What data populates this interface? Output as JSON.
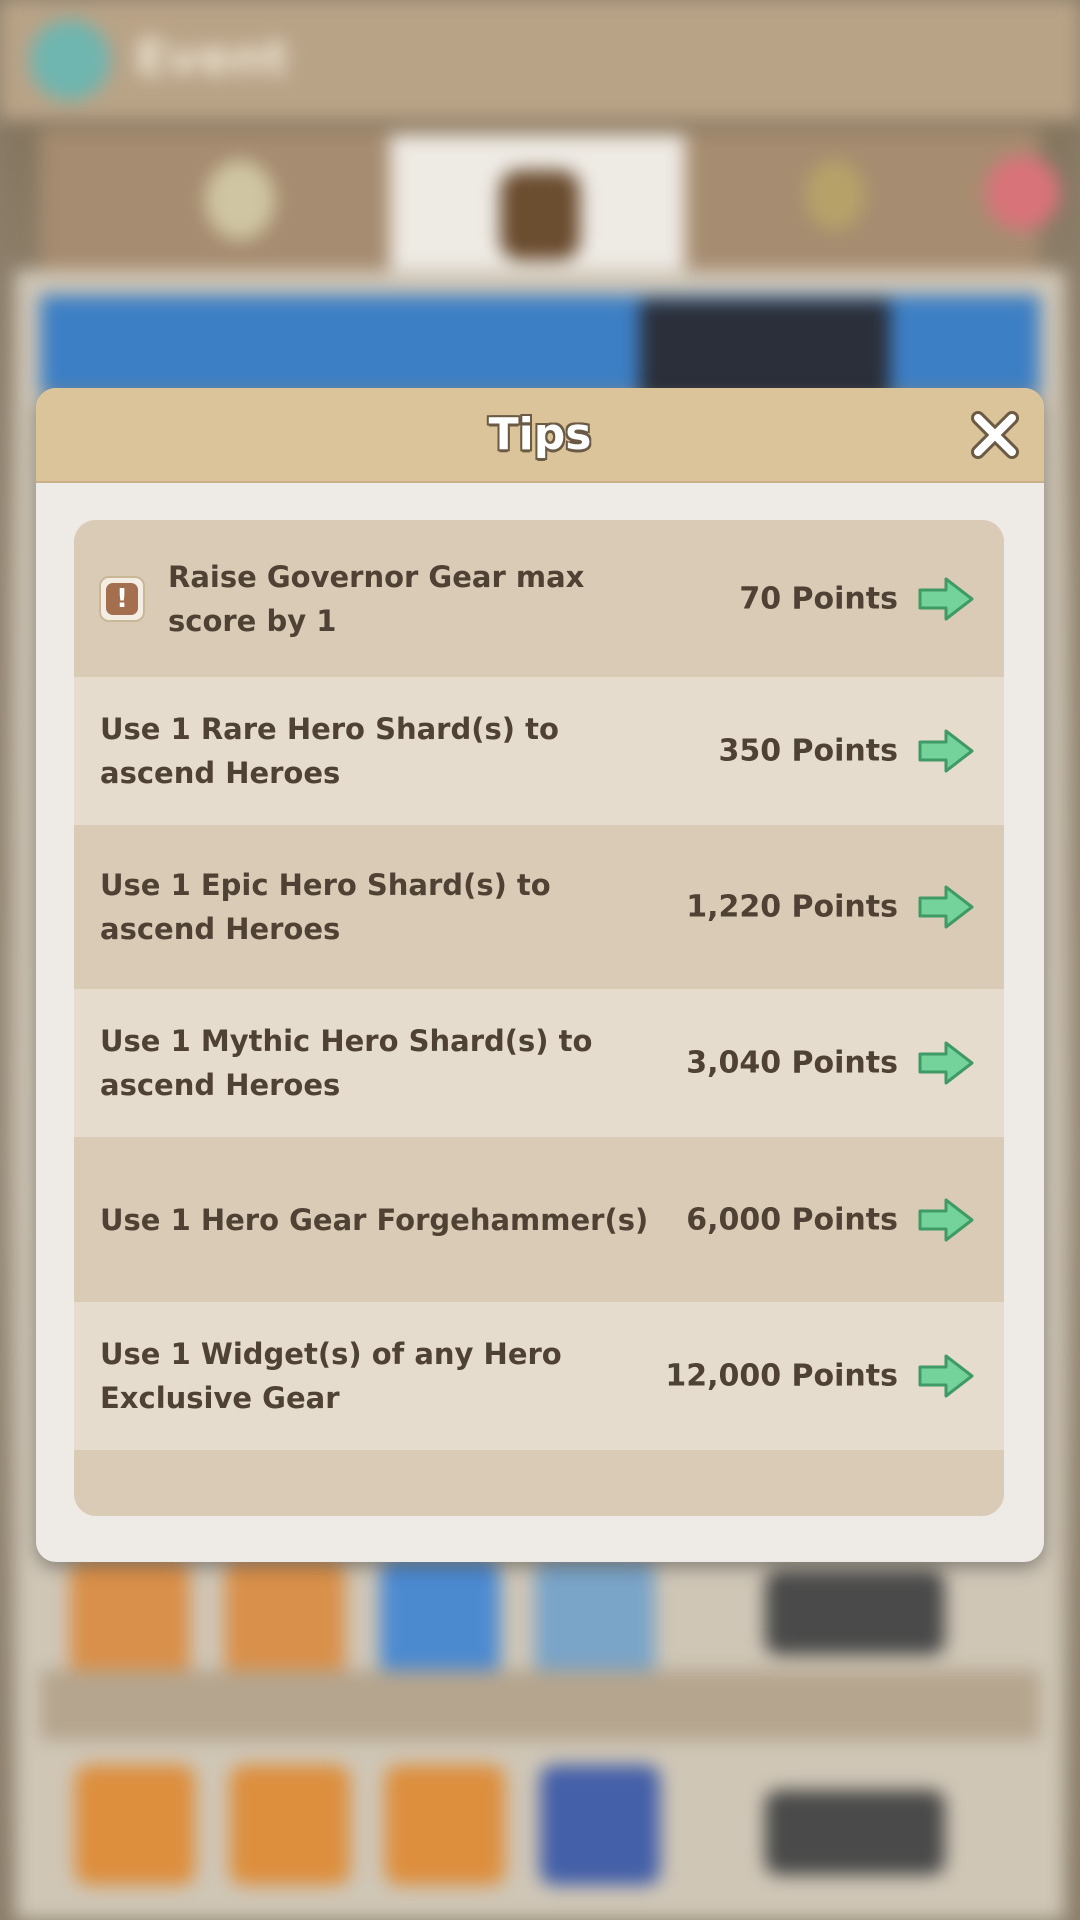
{
  "background": {
    "screen_title": "Event"
  },
  "modal": {
    "title": "Tips",
    "close_icon": "close-icon",
    "tips": [
      {
        "label": "Raise Governor Gear max\nscore by 1",
        "points": "70 Points",
        "has_warning_icon": true,
        "row_style": "dark"
      },
      {
        "label": "Use 1 Rare Hero Shard(s) to\nascend Heroes",
        "points": "350 Points",
        "has_warning_icon": false,
        "row_style": "light"
      },
      {
        "label": "Use 1 Epic Hero Shard(s) to\nascend Heroes",
        "points": "1,220 Points",
        "has_warning_icon": false,
        "row_style": "dark"
      },
      {
        "label": "Use 1 Mythic Hero Shard(s) to\nascend Heroes",
        "points": "3,040 Points",
        "has_warning_icon": false,
        "row_style": "light"
      },
      {
        "label": "Use 1 Hero Gear Forgehammer(s)",
        "points": "6,000 Points",
        "has_warning_icon": false,
        "row_style": "dark"
      },
      {
        "label": "Use 1 Widget(s) of any Hero\nExclusive Gear",
        "points": "12,000 Points",
        "has_warning_icon": false,
        "row_style": "light"
      }
    ]
  },
  "colors": {
    "modal_header": "#dcc49a",
    "modal_body": "#eeebe6",
    "row_dark": "#d9cbb5",
    "row_light": "#e6dccd",
    "text": "#4f4235",
    "arrow_green": "#6fcf97",
    "warning_icon": "#a46f4e"
  }
}
